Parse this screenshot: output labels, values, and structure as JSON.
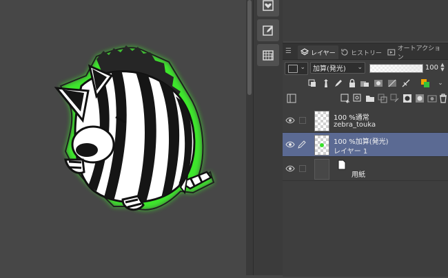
{
  "colors": {
    "panel_bg": "#3e3e3e",
    "canvas_bg": "#474747",
    "selected_row": "#5b6a93",
    "glow_green": "#39e02a"
  },
  "sidebar_icons": [
    "heart-frame-icon",
    "edit-frame-icon",
    "grid-icon"
  ],
  "tabs": [
    {
      "label": "レイヤー",
      "icon": "layers-icon",
      "active": true
    },
    {
      "label": "ヒストリー",
      "icon": "history-icon",
      "active": false
    },
    {
      "label": "オートアクション",
      "icon": "auto-action-icon",
      "active": false
    }
  ],
  "blend": {
    "mode": "加算(発光)",
    "opacity_value": "100",
    "opacity_fraction": 1.0
  },
  "layers": [
    {
      "line1": "100 %通常",
      "line2": "zebra_touka",
      "selected": false,
      "visible": true
    },
    {
      "line1": "100 %加算(発光)",
      "line2": "レイヤー 1",
      "selected": true,
      "visible": true
    },
    {
      "line1": "",
      "line2": "用紙",
      "selected": false,
      "visible": true,
      "paper": true
    }
  ],
  "canvas": {
    "subject": "zebra character illustration with green glow outline"
  }
}
